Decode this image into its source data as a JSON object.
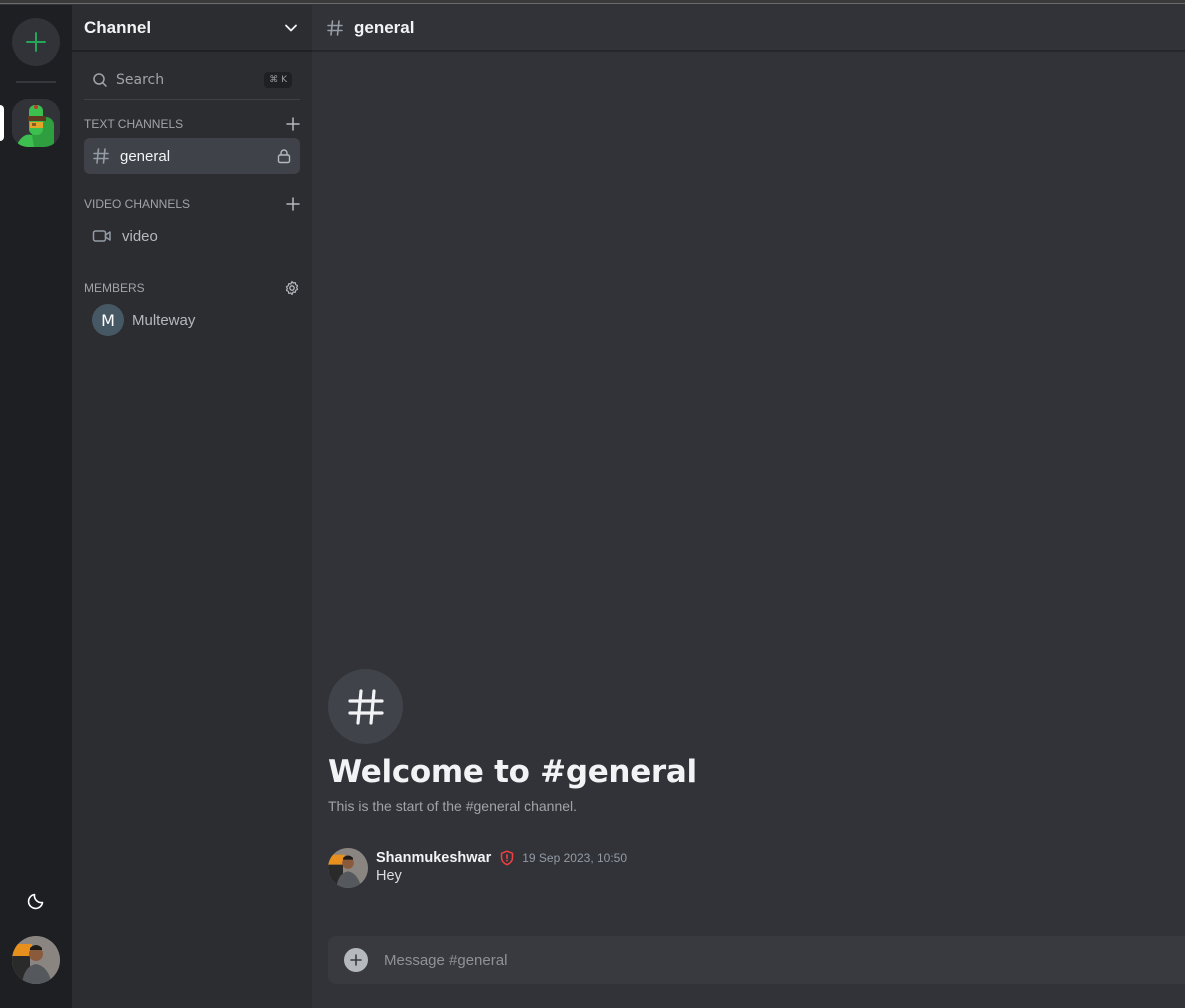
{
  "colors": {
    "accent_green": "#23a55a",
    "danger_red": "#f23f43",
    "rail_bg": "#1e1f22",
    "sidebar_bg": "#2b2d31",
    "main_bg": "#313338"
  },
  "rail": {
    "add_server_icon": "plus-icon",
    "theme_icon": "moon-icon"
  },
  "sidebar": {
    "server_name": "Channel",
    "search": {
      "label": "Search",
      "shortcut": "⌘ K"
    },
    "sections": [
      {
        "title": "TEXT CHANNELS",
        "action_icon": "plus-icon",
        "channels": [
          {
            "name": "general",
            "icon": "hash-icon",
            "active": true,
            "locked": true
          }
        ]
      },
      {
        "title": "VIDEO CHANNELS",
        "action_icon": "plus-icon",
        "channels": [
          {
            "name": "video",
            "icon": "video-camera-icon",
            "active": false
          }
        ]
      },
      {
        "title": "MEMBERS",
        "action_icon": "gear-icon",
        "members": [
          {
            "name": "Multeway",
            "initial": "M"
          }
        ]
      }
    ]
  },
  "main": {
    "channel_name": "general",
    "welcome_title": "Welcome to #general",
    "welcome_subtitle": "This is the start of the #general channel.",
    "messages": [
      {
        "author": "Shanmukeshwar",
        "role_badge": "shield-alert-icon",
        "timestamp": "19 Sep 2023, 10:50",
        "text": "Hey"
      }
    ],
    "composer": {
      "placeholder": "Message #general",
      "value": ""
    }
  }
}
